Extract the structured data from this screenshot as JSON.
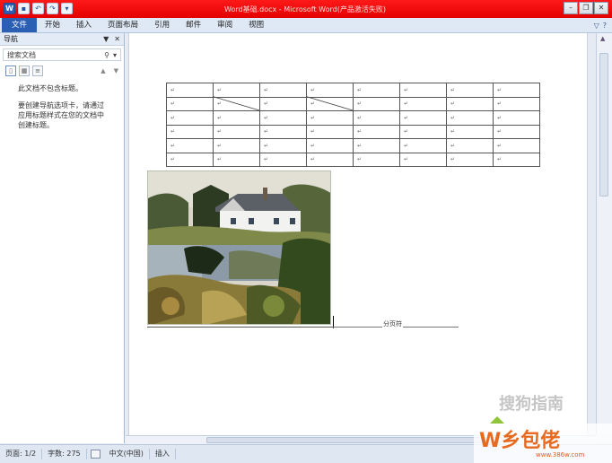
{
  "window": {
    "title": "Word基础.docx - Microsoft Word(产品激活失败)"
  },
  "ribbon": {
    "tabs": [
      "文件",
      "开始",
      "插入",
      "页面布局",
      "引用",
      "邮件",
      "审阅",
      "视图"
    ]
  },
  "navigation": {
    "title": "导航",
    "search_placeholder": "搜索文档",
    "message_line1": "此文档不包含标题。",
    "message_line2": "要创建导航选项卡，请通过应用标题样式在您的文档中创建标题。"
  },
  "document": {
    "table_rows": 6,
    "table_cols": 8,
    "cell_mark": "↵",
    "section_break_label": "分页符"
  },
  "statusbar": {
    "page": "页面: 1/2",
    "words": "字数: 275",
    "language": "中文(中国)",
    "mode": "插入"
  },
  "watermark": {
    "sogou_text": "搜狗指南",
    "brand_text": "W乡包佬",
    "site": "www.386w.com"
  },
  "colors": {
    "titlebar": "#e40000",
    "file_tab": "#2b5fb4"
  }
}
